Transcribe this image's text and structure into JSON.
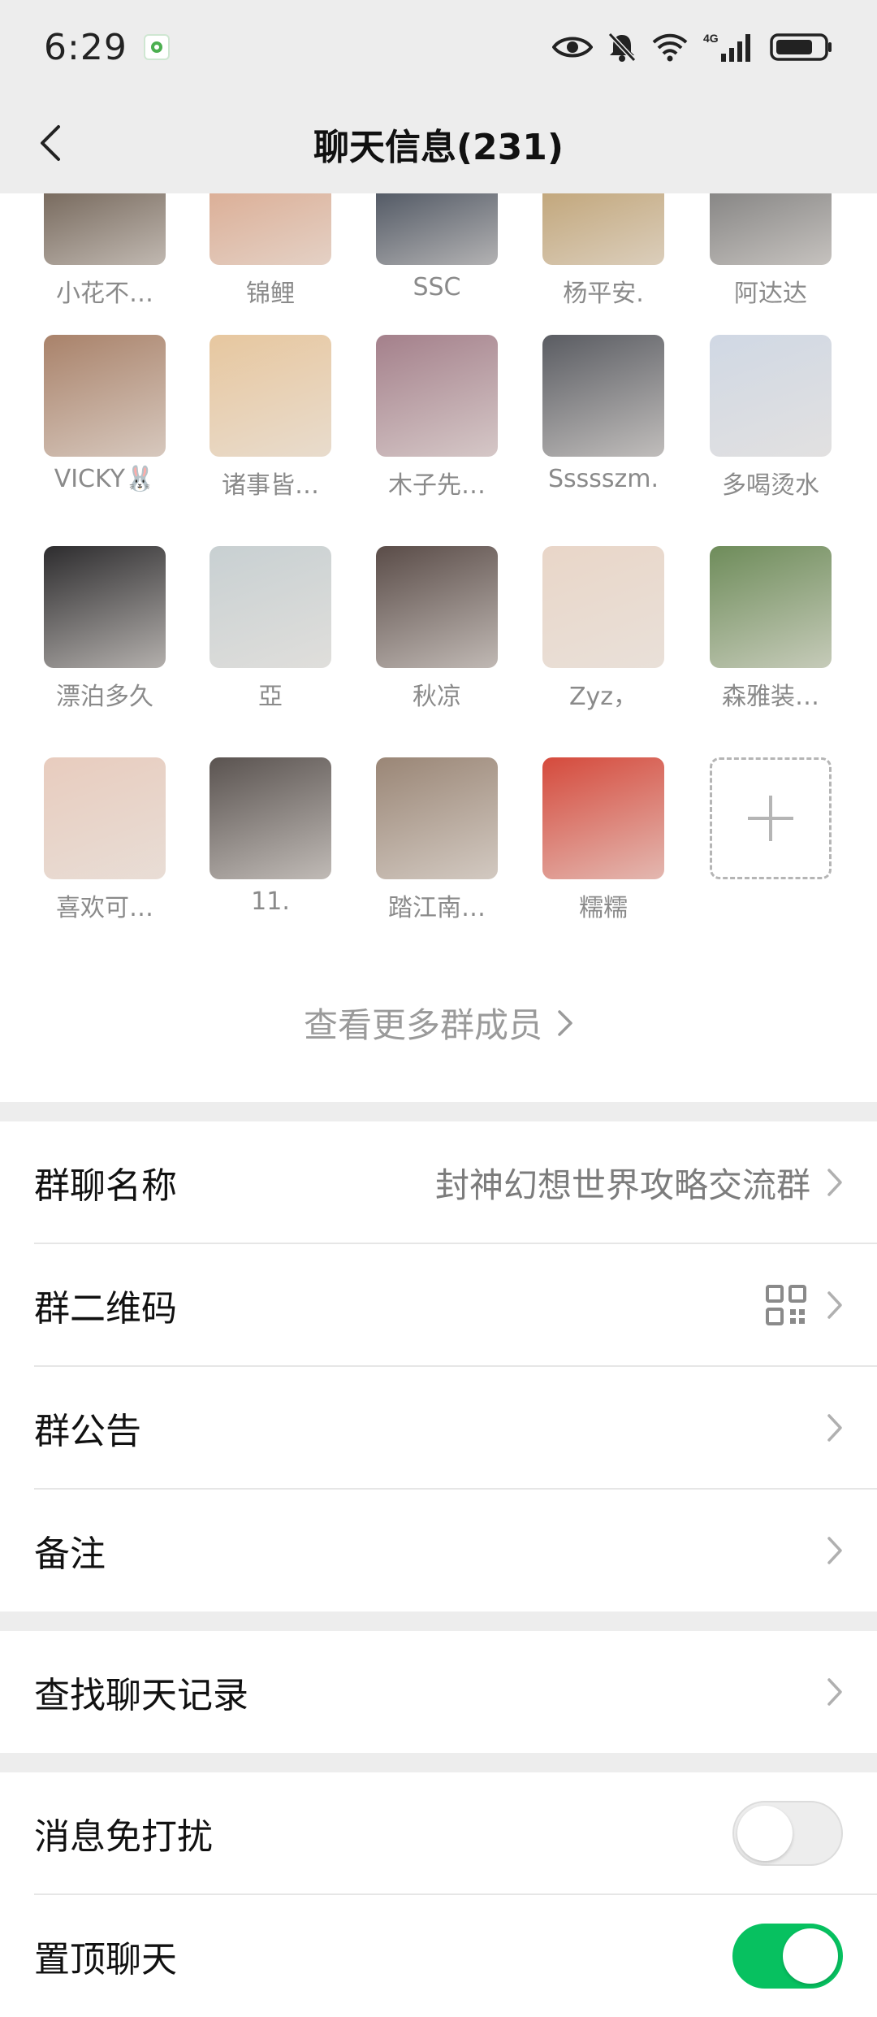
{
  "status_bar": {
    "time": "6:29",
    "icons": [
      "app-notification-icon",
      "eye-icon",
      "bell-muted-icon",
      "wifi-icon",
      "4g-signal-icon",
      "battery-icon"
    ],
    "network_label": "4G"
  },
  "header": {
    "title": "聊天信息(231)"
  },
  "members": [
    {
      "name": "小花不…",
      "color": "#5a4a3c"
    },
    {
      "name": "锦鲤",
      "color": "#d8a184"
    },
    {
      "name": "SSC",
      "color": "#2b3545"
    },
    {
      "name": "杨平安.",
      "color": "#b89762"
    },
    {
      "name": "阿达达",
      "color": "#6d6d6d"
    },
    {
      "name": "VICKY🐰",
      "color": "#a9826a"
    },
    {
      "name": "诸事皆…",
      "color": "#e7c79f"
    },
    {
      "name": "木子先…",
      "color": "#a4808b"
    },
    {
      "name": "Ssssszm.",
      "color": "#5a5c62"
    },
    {
      "name": "多喝烫水",
      "color": "#d0d8e4"
    },
    {
      "name": "漂泊多久",
      "color": "#2d2c2e"
    },
    {
      "name": "亞",
      "color": "#c8d0d2"
    },
    {
      "name": "秋凉",
      "color": "#5a4c48"
    },
    {
      "name": "Zyz，",
      "color": "#e9d6c8"
    },
    {
      "name": "森雅装…",
      "color": "#6e8c5a"
    },
    {
      "name": "喜欢可…",
      "color": "#e8ccbe"
    },
    {
      "name": "11.",
      "color": "#5a5350"
    },
    {
      "name": "踏江南…",
      "color": "#9a8676"
    },
    {
      "name": "糯糯",
      "color": "#d54a3c"
    }
  ],
  "more_members_label": "查看更多群成员",
  "settings": {
    "group_name_label": "群聊名称",
    "group_name_value": "封神幻想世界攻略交流群",
    "qr_label": "群二维码",
    "announcement_label": "群公告",
    "remark_label": "备注",
    "search_history_label": "查找聊天记录",
    "mute_label": "消息免打扰",
    "mute_on": false,
    "pin_label": "置顶聊天",
    "pin_on": true
  },
  "colors": {
    "accent_green": "#07c160",
    "background_gray": "#ededed"
  }
}
